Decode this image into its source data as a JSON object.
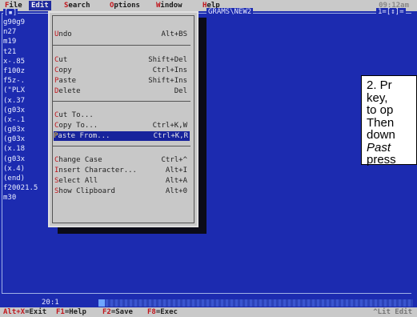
{
  "menubar": {
    "items": [
      {
        "hotkey": "F",
        "rest": "ile"
      },
      {
        "hotkey": "E",
        "rest": "dit"
      },
      {
        "hotkey": "S",
        "rest": "earch"
      },
      {
        "hotkey": "O",
        "rest": "ptions"
      },
      {
        "hotkey": "W",
        "rest": "indow"
      },
      {
        "hotkey": "H",
        "rest": "elp"
      }
    ],
    "clock": "09:12am"
  },
  "editor": {
    "window_number": "[▪]",
    "path": "GRAMS\\NEW2",
    "window_indicator": "1=[↕]=",
    "lines": [
      "g90g9",
      "n27",
      "m19",
      "t21",
      "x-.85",
      "f100z",
      "f5z-.",
      "(\"PLX",
      "(x.37",
      "(g03x",
      "(x-.1",
      "(g03x",
      "(g03x",
      "(x.18",
      "(g03x",
      "(x.4)",
      "(end)",
      "f20021.5",
      "m30"
    ],
    "position": "20:1"
  },
  "edit_menu": {
    "items": [
      {
        "hotkey": "U",
        "rest": "ndo",
        "shortcut": "Alt+BS"
      },
      {
        "hotkey": "C",
        "rest": "ut",
        "shortcut": "Shift+Del"
      },
      {
        "hotkey": "C",
        "rest": "opy",
        "shortcut": "Ctrl+Ins"
      },
      {
        "hotkey": "P",
        "rest": "aste",
        "shortcut": "Shift+Ins"
      },
      {
        "hotkey": "D",
        "rest": "elete",
        "shortcut": "Del"
      },
      {
        "hotkey": "C",
        "rest": "ut To...",
        "shortcut": ""
      },
      {
        "hotkey": "C",
        "rest": "opy To...",
        "shortcut": "Ctrl+K,W"
      },
      {
        "hotkey": "P",
        "rest": "aste From...",
        "shortcut": "Ctrl+K,R"
      },
      {
        "hotkey": "C",
        "rest": "hange Case",
        "shortcut": "Ctrl+^"
      },
      {
        "hotkey": "I",
        "rest": "nsert Character...",
        "shortcut": "Alt+I"
      },
      {
        "hotkey": "S",
        "rest": "elect All",
        "shortcut": "Alt+A"
      },
      {
        "hotkey": "S",
        "rest": "how Clipboard",
        "shortcut": "Alt+0"
      }
    ]
  },
  "callout": {
    "lines": [
      "2. Pr",
      "key,",
      "to op",
      "Then",
      "down",
      "Past",
      "press"
    ]
  },
  "bottombar": {
    "items": [
      {
        "hotkey": "Alt+X",
        "rest": "=Exit"
      },
      {
        "hotkey": "F1",
        "rest": "=Help"
      },
      {
        "hotkey": "F2",
        "rest": "=Save"
      },
      {
        "hotkey": "F8",
        "rest": "=Exec"
      }
    ],
    "right": "^Lit Edit"
  },
  "colors": {
    "background": "#1c2bb0",
    "menubar": "#c9c9c9",
    "hotkey": "#c0151b",
    "selection": "#17239c"
  }
}
